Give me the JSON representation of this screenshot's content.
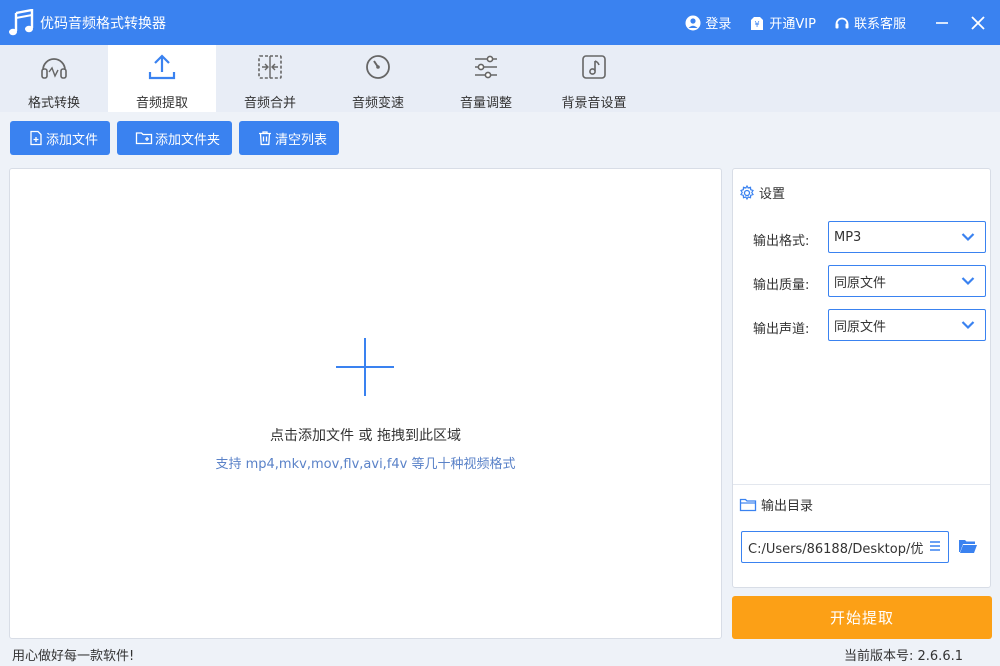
{
  "app": {
    "title": "优码音频格式转换器",
    "accent": "#3a82f0",
    "start_color": "#fca016"
  },
  "title_actions": {
    "login": "登录",
    "vip": "开通VIP",
    "support": "联系客服"
  },
  "tabs": [
    {
      "label": "格式转换",
      "icon": "headphones-icon",
      "active": false
    },
    {
      "label": "音频提取",
      "icon": "upload-icon",
      "active": true
    },
    {
      "label": "音频合并",
      "icon": "merge-icon",
      "active": false
    },
    {
      "label": "音频变速",
      "icon": "speed-icon",
      "active": false
    },
    {
      "label": "音量调整",
      "icon": "sliders-icon",
      "active": false
    },
    {
      "label": "背景音设置",
      "icon": "music-note-icon",
      "active": false
    }
  ],
  "toolbar": {
    "add_file": "添加文件",
    "add_folder": "添加文件夹",
    "clear_list": "清空列表"
  },
  "dropzone": {
    "main_text": "点击添加文件 或 拖拽到此区域",
    "sub_text": "支持 mp4,mkv,mov,flv,avi,f4v 等几十种视频格式"
  },
  "settings": {
    "title": "设置",
    "format_label": "输出格式:",
    "format_value": "MP3",
    "quality_label": "输出质量:",
    "quality_value": "同原文件",
    "channel_label": "输出声道:",
    "channel_value": "同原文件",
    "output_dir_label": "输出目录",
    "output_dir_value": "C:/Users/86188/Desktop/优"
  },
  "start_button": "开始提取",
  "status": {
    "left": "用心做好每一款软件!",
    "version": "当前版本号:  2.6.6.1"
  }
}
